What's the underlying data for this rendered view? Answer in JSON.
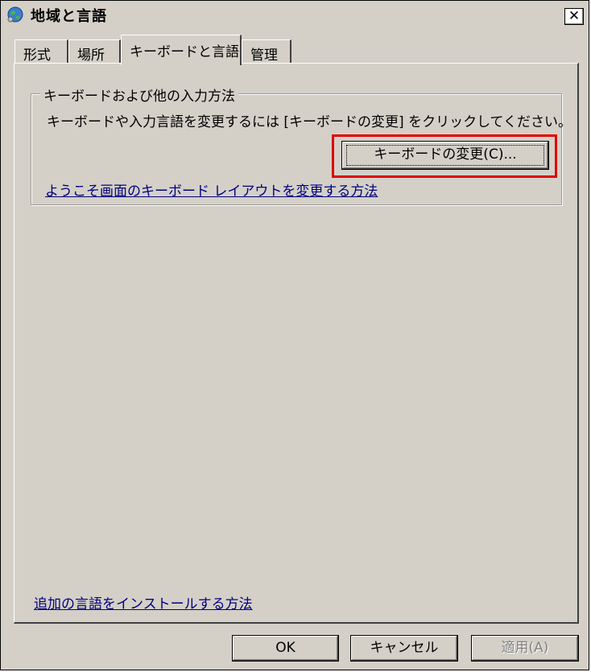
{
  "window": {
    "title": "地域と言語",
    "close_label": "✕"
  },
  "tabs": [
    {
      "label": "形式"
    },
    {
      "label": "場所"
    },
    {
      "label": "キーボードと言語"
    },
    {
      "label": "管理"
    }
  ],
  "group": {
    "title": "キーボードおよび他の入力方法",
    "description": "キーボードや入力言語を変更するには [キーボードの変更] をクリックしてください。",
    "change_button": "キーボードの変更(C)...",
    "welcome_link": "ようこそ画面のキーボード レイアウトを変更する方法"
  },
  "install_link": "追加の言語をインストールする方法",
  "buttons": {
    "ok": "OK",
    "cancel": "キャンセル",
    "apply": "適用(A)"
  },
  "colors": {
    "highlight": "#e00000",
    "link": "#000080",
    "face": "#d4d0c8"
  }
}
